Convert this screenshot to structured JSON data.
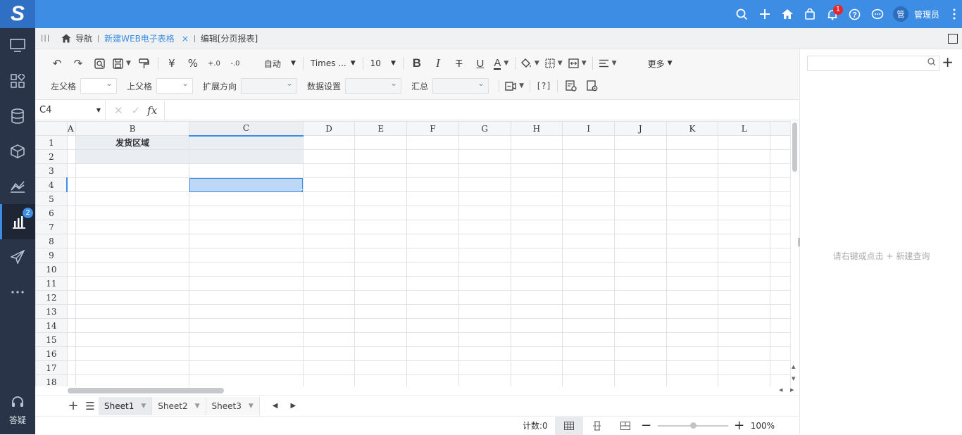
{
  "header": {
    "notifications_count": "1",
    "avatar_text": "管",
    "username": "管理员"
  },
  "sidebar": {
    "reports_badge": "2",
    "help_label": "答疑"
  },
  "tabs": {
    "nav_label": "导航",
    "active_label": "新建WEB电子表格",
    "close_symbol": "×",
    "edit_label": "编辑[分页报表]"
  },
  "toolbar": {
    "undo": "↶",
    "redo": "↷",
    "currency": "¥",
    "percent": "%",
    "inc_decimal": "+.0",
    "dec_decimal": "-.0",
    "format_value": "自动",
    "font_value": "Times ...",
    "size_value": "10",
    "bold": "B",
    "italic": "I",
    "strike": "T",
    "underline": "U",
    "font_color": "A",
    "more_label": "更多",
    "left_parent_label": "左父格",
    "top_parent_label": "上父格",
    "expand_label": "扩展方向",
    "data_settings_label": "数据设置",
    "summary_label": "汇总",
    "param_label": "[?]"
  },
  "formula": {
    "cell_ref": "C4",
    "cancel": "✕",
    "confirm": "✓",
    "fx": "fx"
  },
  "grid": {
    "columns": [
      "A",
      "B",
      "C",
      "D",
      "E",
      "F",
      "G",
      "H",
      "I",
      "J",
      "K",
      "L"
    ],
    "rows": [
      "1",
      "2",
      "3",
      "4",
      "5",
      "6",
      "7",
      "8",
      "9",
      "10",
      "11",
      "12",
      "13",
      "14",
      "15",
      "16",
      "17",
      "18"
    ],
    "b1_text": "发货区域",
    "selected_cell": "C4"
  },
  "sheets": {
    "add": "+",
    "menu": "☰",
    "tabs": [
      "Sheet1",
      "Sheet2",
      "Sheet3"
    ],
    "active": "Sheet1"
  },
  "status": {
    "count_text": "计数:0",
    "zoom": "100%"
  },
  "rightpanel": {
    "search_placeholder": "",
    "empty_hint": "请右键或点击 + 新建查询"
  }
}
